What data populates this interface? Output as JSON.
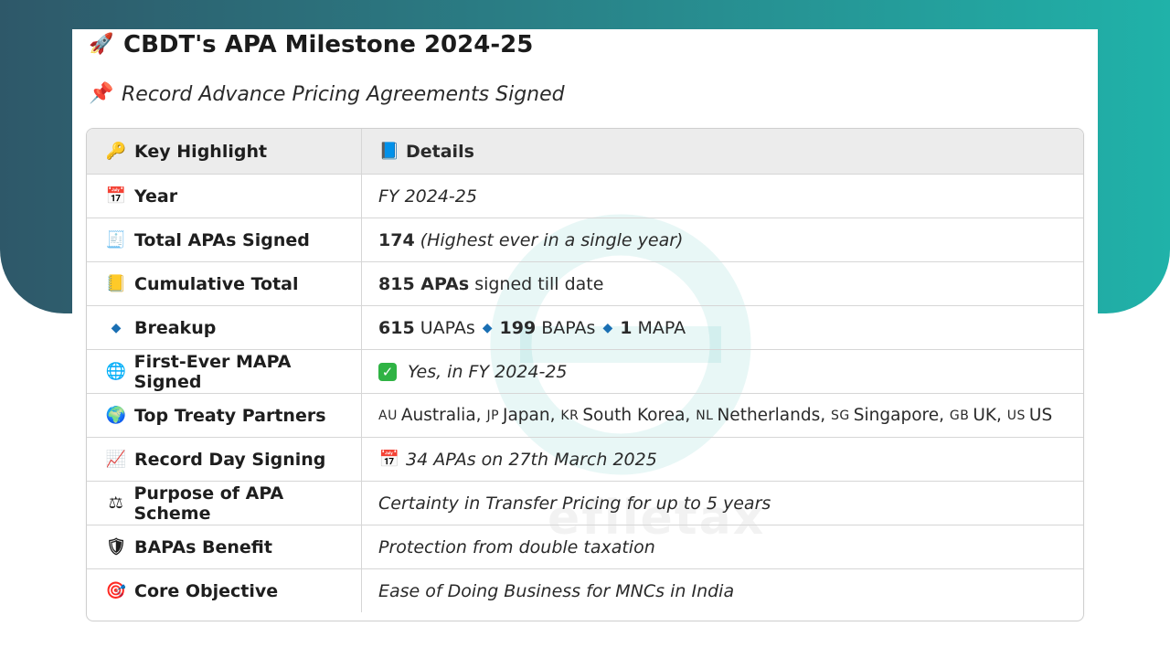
{
  "header": {
    "title_icon": "rocket-icon",
    "title": "CBDT's APA Milestone 2024-25",
    "subtitle_icon": "pushpin-icon",
    "subtitle": "Record Advance Pricing Agreements Signed"
  },
  "table": {
    "headers": [
      {
        "icon": "key-icon",
        "label": "Key Highlight"
      },
      {
        "icon": "blue-book-icon",
        "label": "Details"
      }
    ],
    "rows": [
      {
        "icon": "calendar-icon",
        "label": "Year",
        "detail": "FY 2024-25"
      },
      {
        "icon": "receipt-icon",
        "label": "Total APAs Signed",
        "detail_bold": "174",
        "detail_rest": "(Highest ever in a single year)"
      },
      {
        "icon": "ledger-icon",
        "label": "Cumulative Total",
        "detail_bold": "815 APAs",
        "detail_rest": "signed till date"
      },
      {
        "icon": "diamond-icon",
        "label": "Breakup",
        "parts": [
          {
            "num": "615",
            "txt": "UAPAs"
          },
          {
            "num": "199",
            "txt": "BAPAs"
          },
          {
            "num": "1",
            "txt": "MAPA"
          }
        ]
      },
      {
        "icon": "globe-meridians-icon",
        "label": "First-Ever MAPA Signed",
        "detail": "Yes, in FY 2024-25",
        "check_icon": "check-mark-icon"
      },
      {
        "icon": "earth-globe-icon",
        "label": "Top Treaty Partners",
        "partners": [
          {
            "code": "AU",
            "name": "Australia,"
          },
          {
            "code": "JP",
            "name": "Japan,"
          },
          {
            "code": "KR",
            "name": "South Korea,"
          },
          {
            "code": "NL",
            "name": "Netherlands,"
          },
          {
            "code": "SG",
            "name": "Singapore,"
          },
          {
            "code": "GB",
            "name": "UK,"
          },
          {
            "code": "US",
            "name": "US"
          }
        ]
      },
      {
        "icon": "chart-increasing-icon",
        "label": "Record Day Signing",
        "detail": "34 APAs on 27th March 2025",
        "detail_icon": "calendar-icon"
      },
      {
        "icon": "balance-scale-icon",
        "label": "Purpose of APA Scheme",
        "detail": "Certainty in Transfer Pricing for up to 5 years"
      },
      {
        "icon": "shield-icon",
        "label": "BAPAs Benefit",
        "detail": "Protection from double taxation"
      },
      {
        "icon": "target-icon",
        "label": "Core Objective",
        "detail": "Ease of Doing Business for MNCs in India"
      }
    ]
  },
  "watermark": {
    "text": "efiletax",
    "icon": "e-logo-icon"
  }
}
